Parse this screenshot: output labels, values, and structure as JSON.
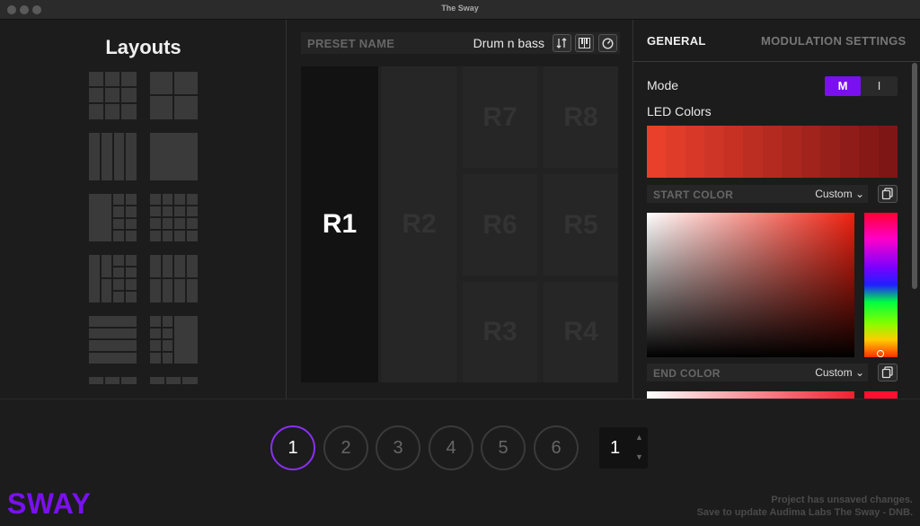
{
  "window": {
    "title": "The Sway"
  },
  "layouts": {
    "title": "Layouts"
  },
  "preset": {
    "label": "PRESET NAME",
    "value": "Drum n bass"
  },
  "zones": [
    "R1",
    "R2",
    "R7",
    "R8",
    "R6",
    "R5",
    "R3",
    "R4"
  ],
  "tabs": {
    "general": "GENERAL",
    "modulation": "MODULATION SETTINGS"
  },
  "mode": {
    "label": "Mode",
    "options": [
      "M",
      "I"
    ],
    "selected": "M"
  },
  "led": {
    "label": "LED Colors",
    "colors": [
      "#e8402a",
      "#e03c2a",
      "#d83828",
      "#cf3526",
      "#c63124",
      "#bd2e22",
      "#b42a20",
      "#aa271e",
      "#a1231c",
      "#98201a",
      "#8f1c18",
      "#861916",
      "#7d1614"
    ]
  },
  "start_color": {
    "label": "START COLOR",
    "mode": "Custom"
  },
  "end_color": {
    "label": "END COLOR",
    "mode": "Custom"
  },
  "pages": [
    "1",
    "2",
    "3",
    "4",
    "5",
    "6"
  ],
  "active_page": "1",
  "stepper": {
    "value": "1"
  },
  "brand": {
    "logo": "SWAY"
  },
  "status": {
    "line1": "Project has unsaved changes.",
    "line2": "Save to update Audima Labs The Sway - DNB."
  },
  "colors": {
    "accent": "#7a10f0",
    "background": "#1c1c1c"
  }
}
